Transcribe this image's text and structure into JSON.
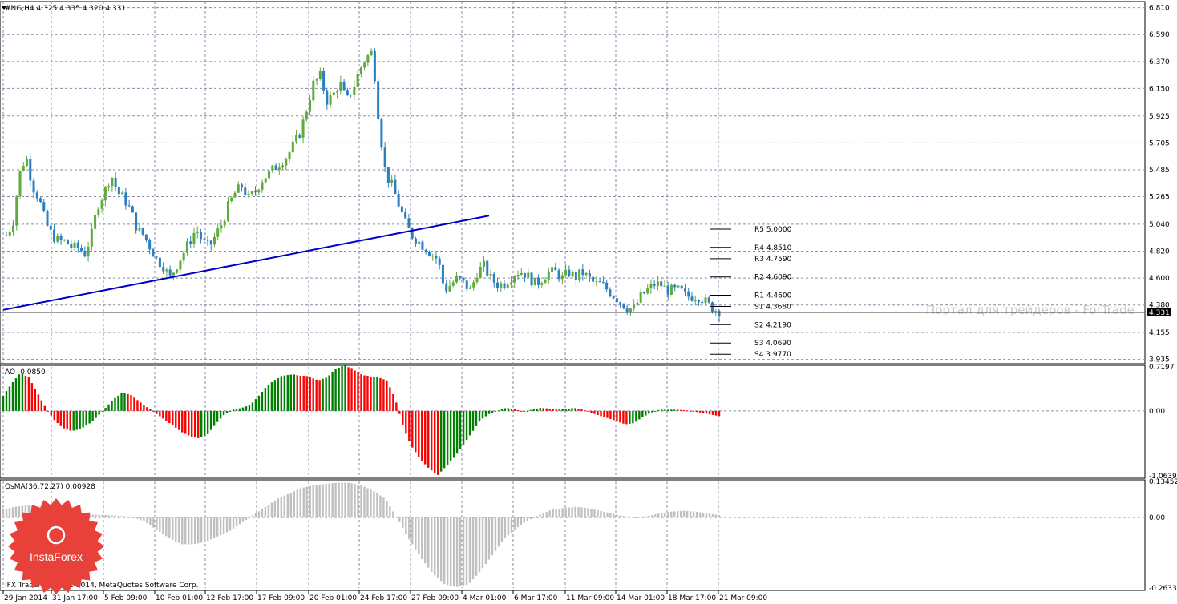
{
  "symbol_header": "#NG,H4  4.325 4.335 4.320 4.331",
  "watermark": "Портал для трейдеров - ForTrade",
  "copyright": "IFX Trader, © 2001-2014, MetaQuotes Software Corp.",
  "logo": {
    "text": "InstaForex",
    "color": "#e8413a"
  },
  "price_marker": "4.331",
  "colors": {
    "up": "#5faa3c",
    "down": "#2a7fc1",
    "trend": "#0000c8",
    "ao_up": "#008000",
    "ao_down": "#ff0000",
    "osma": "#c0c0c0",
    "grid": "#8a8aa8"
  },
  "main_axis": {
    "ticks": [
      "6.810",
      "6.590",
      "6.370",
      "6.150",
      "5.925",
      "5.705",
      "5.485",
      "5.265",
      "5.040",
      "4.820",
      "4.600",
      "4.380",
      "4.155",
      "3.935"
    ],
    "range": [
      3.9,
      6.86
    ]
  },
  "ao_panel": {
    "title": "AO -0.0850",
    "ticks": [
      "0.7197",
      "0.00",
      "-1.0639"
    ],
    "range": [
      -1.0639,
      0.7197
    ]
  },
  "osma_panel": {
    "title": "OsMA(36,72,27) 0.00928",
    "ticks": [
      "0.13452",
      "0.00",
      "-0.2633"
    ],
    "range": [
      -0.2633,
      0.13452
    ]
  },
  "time_labels": [
    "29 Jan 2014",
    "31 Jan 17:00",
    "5 Feb 09:00",
    "10 Feb 01:00",
    "12 Feb 17:00",
    "17 Feb 09:00",
    "20 Feb 01:00",
    "24 Feb 17:00",
    "27 Feb 09:00",
    "4 Mar 01:00",
    "6 Mar 17:00",
    "11 Mar 09:00",
    "14 Mar 01:00",
    "18 Mar 17:00",
    "21 Mar 09:00"
  ],
  "pivots": [
    {
      "label": "R5 5.0000",
      "value": 5.0
    },
    {
      "label": "R4 4.8510",
      "value": 4.851
    },
    {
      "label": "R3 4.7590",
      "value": 4.759
    },
    {
      "label": "R2 4.6090",
      "value": 4.609
    },
    {
      "label": "R1 4.4600",
      "value": 4.46
    },
    {
      "label": "S1 4.3680",
      "value": 4.368
    },
    {
      "label": "S2 4.2190",
      "value": 4.219
    },
    {
      "label": "S3 4.0690",
      "value": 4.069
    },
    {
      "label": "S4 3.9770",
      "value": 3.977
    }
  ],
  "chart_data": {
    "type": "candlestick",
    "title": "#NG,H4",
    "last_quote": {
      "open": 4.325,
      "high": 4.335,
      "low": 4.32,
      "close": 4.331
    },
    "x_labels": [
      "29 Jan 2014",
      "31 Jan 17:00",
      "5 Feb 09:00",
      "10 Feb 01:00",
      "12 Feb 17:00",
      "17 Feb 09:00",
      "20 Feb 01:00",
      "24 Feb 17:00",
      "27 Feb 09:00",
      "4 Mar 01:00",
      "6 Mar 17:00",
      "11 Mar 09:00",
      "14 Mar 01:00",
      "18 Mar 17:00",
      "21 Mar 09:00"
    ],
    "ylim": [
      3.935,
      6.81
    ],
    "close_path": [
      4.95,
      5.05,
      5.45,
      5.6,
      5.35,
      5.25,
      5.05,
      4.95,
      4.9,
      4.9,
      4.85,
      4.85,
      4.8,
      4.95,
      5.2,
      5.3,
      5.45,
      5.3,
      5.25,
      5.15,
      5.0,
      4.95,
      4.85,
      4.75,
      4.7,
      4.6,
      4.7,
      4.8,
      4.9,
      5.0,
      4.9,
      4.85,
      4.95,
      5.05,
      5.2,
      5.3,
      5.35,
      5.25,
      5.3,
      5.4,
      5.45,
      5.5,
      5.55,
      5.6,
      5.7,
      5.8,
      6.0,
      6.2,
      6.25,
      6.05,
      6.1,
      6.2,
      6.05,
      6.15,
      6.3,
      6.4,
      6.45,
      5.85,
      5.45,
      5.35,
      5.2,
      5.05,
      4.95,
      4.9,
      4.85,
      4.8,
      4.75,
      4.5,
      4.55,
      4.6,
      4.55,
      4.5,
      4.65,
      4.7,
      4.6,
      4.55,
      4.55,
      4.6,
      4.65,
      4.65,
      4.6,
      4.55,
      4.6,
      4.65,
      4.65,
      4.6,
      4.65,
      4.6,
      4.65,
      4.6,
      4.55,
      4.55,
      4.5,
      4.45,
      4.4,
      4.35,
      4.35,
      4.45,
      4.5,
      4.55,
      4.55,
      4.5,
      4.5,
      4.5,
      4.45,
      4.45,
      4.45,
      4.4,
      4.35,
      4.33
    ],
    "trend_line": {
      "from": {
        "x": "29 Jan 2014",
        "y": 4.34
      },
      "to": {
        "x": "27 Feb 09:00",
        "y": 5.11
      }
    },
    "ao_values": [
      0.25,
      0.45,
      0.62,
      0.55,
      0.3,
      0.05,
      -0.15,
      -0.28,
      -0.33,
      -0.3,
      -0.22,
      -0.1,
      0.05,
      0.2,
      0.3,
      0.26,
      0.15,
      0.05,
      -0.05,
      -0.15,
      -0.25,
      -0.35,
      -0.42,
      -0.45,
      -0.38,
      -0.2,
      -0.05,
      0.02,
      0.05,
      0.1,
      0.25,
      0.42,
      0.52,
      0.58,
      0.6,
      0.57,
      0.55,
      0.5,
      0.55,
      0.68,
      0.75,
      0.68,
      0.6,
      0.55,
      0.55,
      0.5,
      0.2,
      -0.3,
      -0.6,
      -0.8,
      -0.95,
      -1.05,
      -0.9,
      -0.75,
      -0.55,
      -0.35,
      -0.15,
      -0.05,
      0.0,
      0.05,
      0.03,
      -0.02,
      0.02,
      0.05,
      0.04,
      0.02,
      0.03,
      0.05,
      0.02,
      -0.03,
      -0.08,
      -0.12,
      -0.17,
      -0.22,
      -0.2,
      -0.1,
      -0.03,
      0.02,
      0.02,
      0.02,
      0.01,
      -0.01,
      -0.03,
      -0.06,
      -0.085
    ],
    "osma_values": [
      0.03,
      0.04,
      0.045,
      0.04,
      0.03,
      0.02,
      0.015,
      0.01,
      0.01,
      0.008,
      0.005,
      0.0,
      -0.02,
      -0.05,
      -0.08,
      -0.1,
      -0.1,
      -0.09,
      -0.07,
      -0.05,
      -0.02,
      0.01,
      0.04,
      0.07,
      0.09,
      0.11,
      0.12,
      0.125,
      0.13,
      0.13,
      0.12,
      0.1,
      0.07,
      0.0,
      -0.08,
      -0.15,
      -0.21,
      -0.25,
      -0.26,
      -0.25,
      -0.2,
      -0.14,
      -0.08,
      -0.04,
      -0.01,
      0.01,
      0.03,
      0.035,
      0.04,
      0.035,
      0.025,
      0.015,
      0.005,
      0.0,
      0.005,
      0.015,
      0.022,
      0.025,
      0.022,
      0.015,
      0.009
    ],
    "ao_title": "AO -0.0850",
    "osma_title": "OsMA(36,72,27) 0.00928"
  }
}
